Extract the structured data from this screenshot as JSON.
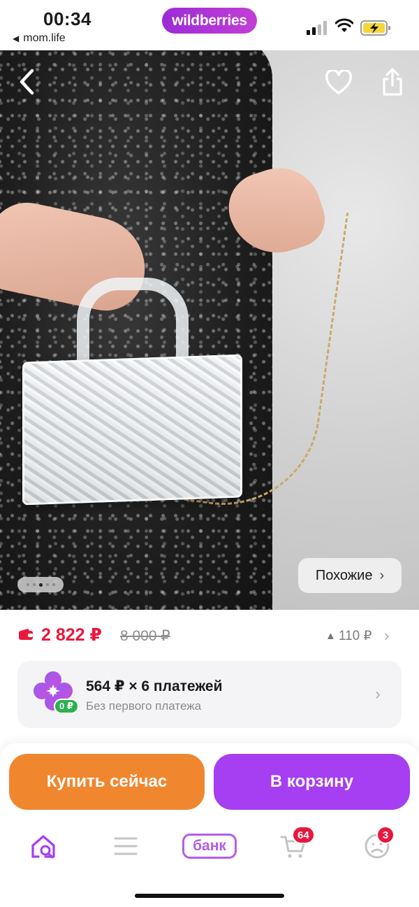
{
  "status_bar": {
    "time": "00:34",
    "back_app": "mom.life",
    "app_brand": "wildberries",
    "signal_icon": "cellular-signal-icon",
    "wifi_icon": "wifi-icon",
    "battery_icon": "battery-charging-icon"
  },
  "hero": {
    "image_alt": "product-photo",
    "back_icon": "chevron-left-icon",
    "favorite_icon": "heart-outline-icon",
    "share_icon": "share-icon",
    "similar_label": "Похожие",
    "similar_chevron": "›",
    "carousel_pages": 5,
    "carousel_active_index": 2
  },
  "price": {
    "current": "2 822 ₽",
    "old": "8 000 ₽",
    "bonus": "110 ₽",
    "bonus_icon": "triangle-up-icon",
    "wallet_icon": "wallet-icon"
  },
  "installment": {
    "icon": "clover-icon",
    "badge": "0 ₽",
    "title": "564 ₽ × 6 платежей",
    "subtitle": "Без первого платежа"
  },
  "actions": {
    "buy_now": "Купить сейчас",
    "add_to_cart": "В корзину"
  },
  "tab_bar": {
    "home_icon": "home-search-icon",
    "catalog_icon": "menu-icon",
    "bank_label": "банк",
    "cart_icon": "cart-icon",
    "cart_badge": "64",
    "profile_icon": "profile-icon",
    "profile_badge": "3"
  },
  "colors": {
    "brand_purple": "#a63ef1",
    "buy_orange": "#f0862e",
    "price_red": "#e8183c",
    "badge_green": "#2bb24c"
  }
}
